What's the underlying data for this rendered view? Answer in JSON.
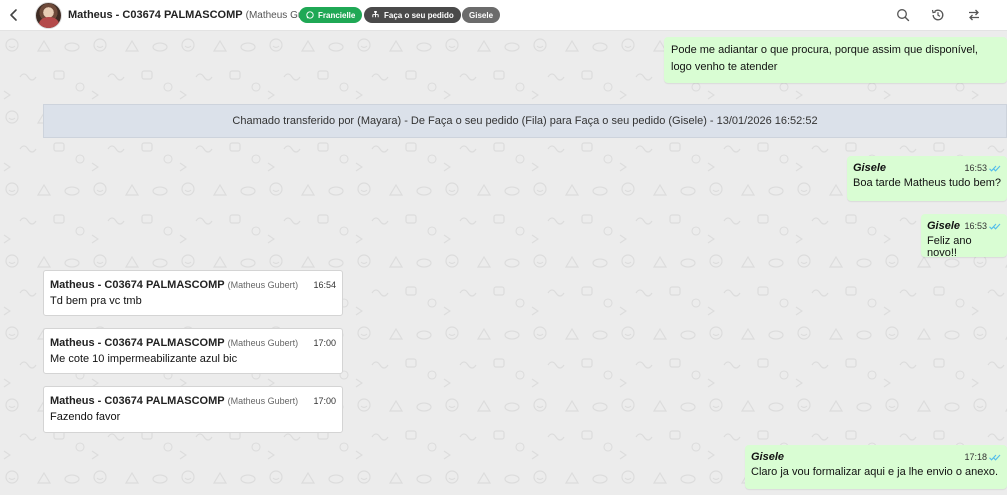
{
  "header": {
    "contact_name": "Matheus - C03674 PALMASCOMP",
    "contact_sub": "(Matheus Gubert)",
    "tags": [
      {
        "label": "Francielle",
        "icon": "whatsapp-icon",
        "color": "#1fa855"
      },
      {
        "label": "Faça o seu pedido",
        "icon": "queue-icon",
        "color": "#4a4a4a"
      },
      {
        "label": "Gisele",
        "color": "#6b6b6b"
      }
    ],
    "icons": [
      "back-arrow-icon",
      "search-icon",
      "history-icon",
      "transfer-icon"
    ]
  },
  "messages": {
    "m1": {
      "text_line1": "Pode me adiantar o que procura, porque assim que disponível,",
      "text_line2": "logo venho te atender"
    },
    "system_banner": "Chamado transferido por (Mayara) - De Faça o seu pedido (Fila) para Faça o seu pedido (Gisele) - 13/01/2026 16:52:52",
    "m2": {
      "sender": "Gisele",
      "time": "16:53",
      "text": "Boa tarde Matheus tudo bem?"
    },
    "m3": {
      "sender": "Gisele",
      "time": "16:53",
      "text": "Feliz ano novo!!"
    },
    "m4": {
      "sender": "Matheus - C03674 PALMASCOMP",
      "sender_sub": "(Matheus Gubert)",
      "time": "16:54",
      "text": "Td bem pra vc tmb"
    },
    "m5": {
      "sender": "Matheus - C03674 PALMASCOMP",
      "sender_sub": "(Matheus Gubert)",
      "time": "17:00",
      "text": "Me cote 10 impermeabilizante azul bic"
    },
    "m6": {
      "sender": "Matheus - C03674 PALMASCOMP",
      "sender_sub": "(Matheus Gubert)",
      "time": "17:00",
      "text": "Fazendo favor"
    },
    "m7": {
      "sender": "Gisele",
      "time": "17:18",
      "text": "Claro ja vou formalizar aqui e ja lhe envio o anexo."
    }
  },
  "colors": {
    "outgoing_bubble": "#d9fdd3",
    "incoming_bubble": "#ffffff",
    "banner": "#dbe1ea",
    "read_check": "#53bdeb",
    "background": "#ececec"
  }
}
